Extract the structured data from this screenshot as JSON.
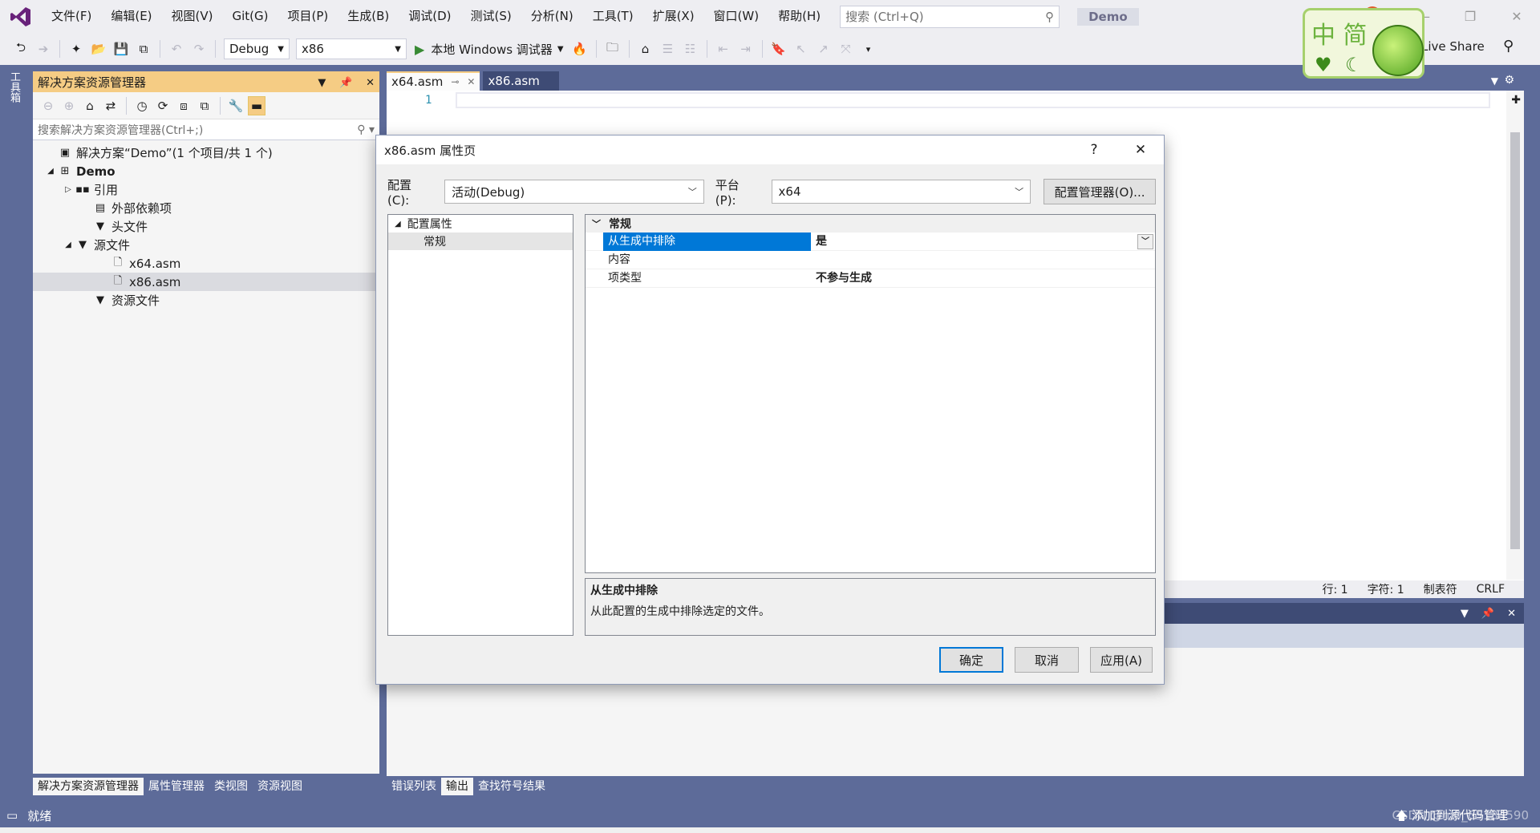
{
  "menubar": {
    "items": [
      "文件(F)",
      "编辑(E)",
      "视图(V)",
      "Git(G)",
      "项目(P)",
      "生成(B)",
      "调试(D)",
      "测试(S)",
      "分析(N)",
      "工具(T)",
      "扩展(X)",
      "窗口(W)",
      "帮助(H)"
    ],
    "search_placeholder": "搜索 (Ctrl+Q)",
    "solution_name": "Demo"
  },
  "ime_widget": {
    "text": "中 简"
  },
  "toolbar": {
    "config": "Debug",
    "platform": "x86",
    "run_label": "本地 Windows 调试器",
    "live_share": "Live Share"
  },
  "left_strip": {
    "label": "工具箱"
  },
  "solution_explorer": {
    "title": "解决方案资源管理器",
    "search_placeholder": "搜索解决方案资源管理器(Ctrl+;)",
    "tree": [
      {
        "label": "解决方案“Demo”(1 个项目/共 1 个)",
        "level": 0,
        "expander": "",
        "icon": "▣",
        "bold": false,
        "selected": false
      },
      {
        "label": "Demo",
        "level": 0,
        "expander": "◢",
        "icon": "⊞",
        "bold": true,
        "selected": false
      },
      {
        "label": "引用",
        "level": 1,
        "expander": "▷",
        "icon": "▪▪",
        "bold": false,
        "selected": false
      },
      {
        "label": "外部依赖项",
        "level": 2,
        "expander": "",
        "icon": "▤",
        "bold": false,
        "selected": false
      },
      {
        "label": "头文件",
        "level": 2,
        "expander": "",
        "icon": "▼",
        "bold": false,
        "selected": false
      },
      {
        "label": "源文件",
        "level": 1,
        "expander": "◢",
        "icon": "▼",
        "bold": false,
        "selected": false
      },
      {
        "label": "x64.asm",
        "level": 3,
        "expander": "",
        "icon": "🗋",
        "bold": false,
        "selected": false
      },
      {
        "label": "x86.asm",
        "level": 3,
        "expander": "",
        "icon": "🗋",
        "bold": false,
        "selected": true
      },
      {
        "label": "资源文件",
        "level": 2,
        "expander": "",
        "icon": "▼",
        "bold": false,
        "selected": false
      }
    ],
    "bottom_tabs": [
      "解决方案资源管理器",
      "属性管理器",
      "类视图",
      "资源视图"
    ]
  },
  "editor": {
    "tabs": [
      {
        "label": "x64.asm",
        "active": true
      },
      {
        "label": "x86.asm",
        "active": false
      }
    ],
    "line_number": "1",
    "status": {
      "line": "行: 1",
      "char": "字符: 1",
      "indent": "制表符",
      "eol": "CRLF"
    }
  },
  "output_panel": {
    "bottom_tabs": [
      "错误列表",
      "输出",
      "查找符号结果"
    ]
  },
  "statusbar": {
    "text": "就绪",
    "right": "添加到源代码管理",
    "watermark": "CSDN @m0_65134590"
  },
  "dialog": {
    "title": "x86.asm 属性页",
    "help": "?",
    "close": "✕",
    "config_label": "配置(C):",
    "config_value": "活动(Debug)",
    "platform_label": "平台(P):",
    "platform_value": "x64",
    "config_manager": "配置管理器(O)...",
    "tree": [
      {
        "label": "配置属性",
        "expander": "◢",
        "selected": false
      },
      {
        "label": "常规",
        "expander": "",
        "selected": true
      }
    ],
    "category": "常规",
    "properties": [
      {
        "name": "从生成中排除",
        "value": "是",
        "selected": true
      },
      {
        "name": "内容",
        "value": "",
        "selected": false
      },
      {
        "name": "项类型",
        "value": "不参与生成",
        "selected": false
      }
    ],
    "desc_title": "从生成中排除",
    "desc_text": "从此配置的生成中排除选定的文件。",
    "ok": "确定",
    "cancel": "取消",
    "apply": "应用(A)"
  }
}
